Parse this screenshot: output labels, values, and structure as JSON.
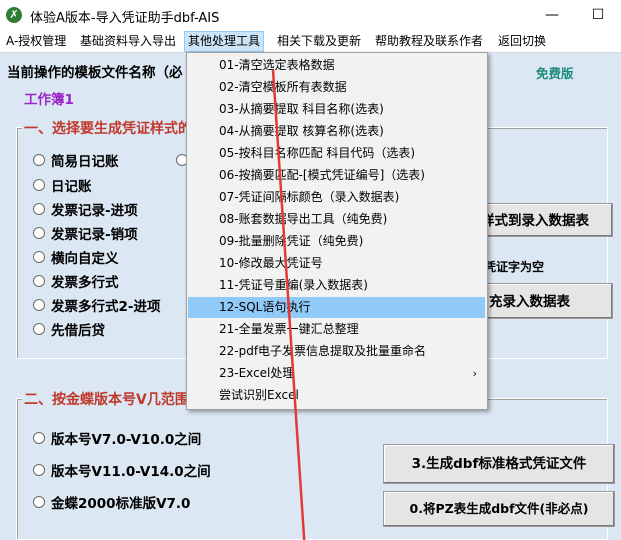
{
  "window": {
    "title": "体验A版本-导入凭证助手dbf-AIS",
    "minimize_glyph": "—",
    "maximize_glyph": "☐"
  },
  "menubar": [
    "A-授权管理",
    "基础资料导入导出",
    "其他处理工具",
    "相关下载及更新",
    "帮助教程及联系作者",
    "返回切换"
  ],
  "main": {
    "template_label": "当前操作的模板文件名称（必",
    "free_badge": "免费版",
    "workbook": "工作簿1",
    "section1_title": "一、选择要生成凭证样式的",
    "section1_options": [
      "简易日记账",
      "日记账",
      "发票记录-进项",
      "发票记录-销项",
      "横向自定义",
      "发票多行式",
      "发票多行式2-进项",
      "先借后贷"
    ],
    "btn_style_to_entry": "样式到录入数据表",
    "voucher_empty_note": "凭证字为空",
    "btn_fill_entry": "充录入数据表",
    "section2_title": "二、按金蝶版本号V几范围",
    "section2_options": [
      "版本号V7.0-V10.0之间",
      "版本号V11.0-V14.0之间",
      "金蝶2000标准版V7.0"
    ],
    "btn_generate_dbf": "3.生成dbf标准格式凭证文件",
    "btn_pz_to_dbf": "0.将PZ表生成dbf文件(非必点)"
  },
  "dropdown": {
    "items": [
      "01-清空选定表格数据",
      "02-清空模板所有表数据",
      "03-从摘要提取 科目名称(选表)",
      "04-从摘要提取 核算名称(选表)",
      "05-按科目名称匹配 科目代码（选表)",
      "06-按摘要匹配-[模式凭证编号]（选表)",
      "07-凭证间隔标颜色（录入数据表)",
      "08-账套数据导出工具（纯免费)",
      "09-批量删除凭证（纯免费)",
      "10-修改最大凭证号",
      "11-凭证号重编(录入数据表)",
      "12-SQL语句执行",
      "21-全量发票一键汇总整理",
      "22-pdf电子发票信息提取及批量重命名",
      "23-Excel处理",
      "尝试识别Excel"
    ],
    "highlighted_index": 11,
    "submenu_arrow": "›",
    "highlight_color": "#91c9f7"
  },
  "annotation": {
    "arrow_color": "#e53935"
  }
}
